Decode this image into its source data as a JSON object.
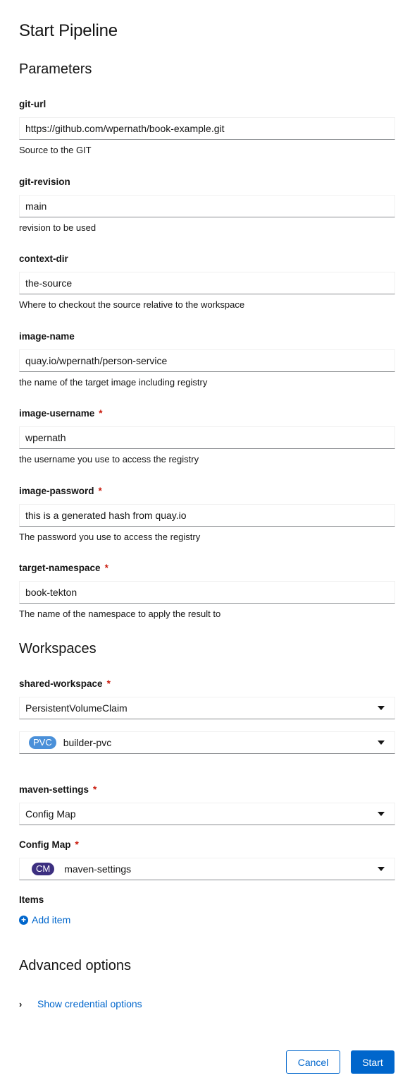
{
  "page": {
    "title": "Start Pipeline"
  },
  "parameters": {
    "heading": "Parameters",
    "fields": [
      {
        "label": "git-url",
        "required": false,
        "value": "https://github.com/wpernath/book-example.git",
        "helper": "Source to the GIT"
      },
      {
        "label": "git-revision",
        "required": false,
        "value": "main",
        "helper": "revision to be used"
      },
      {
        "label": "context-dir",
        "required": false,
        "value": "the-source",
        "helper": "Where to checkout the source relative to the workspace"
      },
      {
        "label": "image-name",
        "required": false,
        "value": "quay.io/wpernath/person-service",
        "helper": "the name of the target image including registry"
      },
      {
        "label": "image-username",
        "required": true,
        "value": "wpernath",
        "helper": "the username you use to access the registry"
      },
      {
        "label": "image-password",
        "required": true,
        "value": "this is a generated hash from quay.io",
        "helper": "The password you use to access the registry"
      },
      {
        "label": "target-namespace",
        "required": true,
        "value": "book-tekton",
        "helper": "The name of the namespace to apply the result to"
      }
    ]
  },
  "workspaces": {
    "heading": "Workspaces",
    "shared_workspace": {
      "label": "shared-workspace",
      "required_mark": "*",
      "type_value": "PersistentVolumeClaim",
      "resource_badge": "PVC",
      "resource_badge_color": "#4a90d9",
      "resource_value": "builder-pvc"
    },
    "maven_settings": {
      "label": "maven-settings",
      "required_mark": "*",
      "type_value": "Config Map",
      "configmap_label": "Config Map",
      "resource_badge": "CM",
      "resource_badge_color": "#3c2f80",
      "resource_value": "maven-settings",
      "items_label": "Items",
      "add_item_label": "Add item"
    }
  },
  "advanced": {
    "heading": "Advanced options",
    "show_credentials_label": "Show credential options"
  },
  "footer": {
    "cancel_label": "Cancel",
    "start_label": "Start"
  },
  "colors": {
    "primary": "#0066cc",
    "required": "#c9190b"
  }
}
